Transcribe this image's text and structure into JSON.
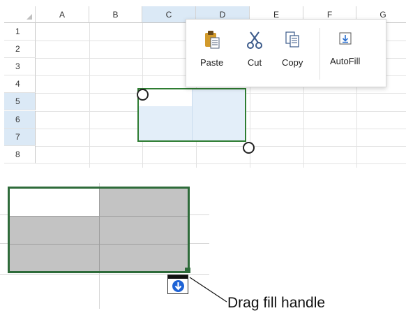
{
  "sheet": {
    "corner_label": "",
    "columns": [
      {
        "label": "A",
        "selected": false
      },
      {
        "label": "B",
        "selected": false
      },
      {
        "label": "C",
        "selected": true
      },
      {
        "label": "D",
        "selected": true
      },
      {
        "label": "E",
        "selected": false
      },
      {
        "label": "F",
        "selected": false
      },
      {
        "label": "G",
        "selected": false
      }
    ],
    "rows": [
      {
        "label": "1",
        "selected": false
      },
      {
        "label": "2",
        "selected": false
      },
      {
        "label": "3",
        "selected": false
      },
      {
        "label": "4",
        "selected": false
      },
      {
        "label": "5",
        "selected": true
      },
      {
        "label": "6",
        "selected": true
      },
      {
        "label": "7",
        "selected": true
      },
      {
        "label": "8",
        "selected": false
      }
    ],
    "selection_color": "#2e7d32",
    "selection_fill": "#e3eef9"
  },
  "context_menu": {
    "items": [
      {
        "label": "Paste",
        "icon": "paste-icon"
      },
      {
        "label": "Cut",
        "icon": "scissors-icon"
      },
      {
        "label": "Copy",
        "icon": "copy-icon"
      },
      {
        "label": "AutoFill",
        "icon": "autofill-icon"
      }
    ]
  },
  "illustration": {
    "callout": "Drag fill handle",
    "autofill_icon": "down-arrow-icon",
    "range_color": "#2e6b3a",
    "fill_color": "#c3c3c3"
  }
}
